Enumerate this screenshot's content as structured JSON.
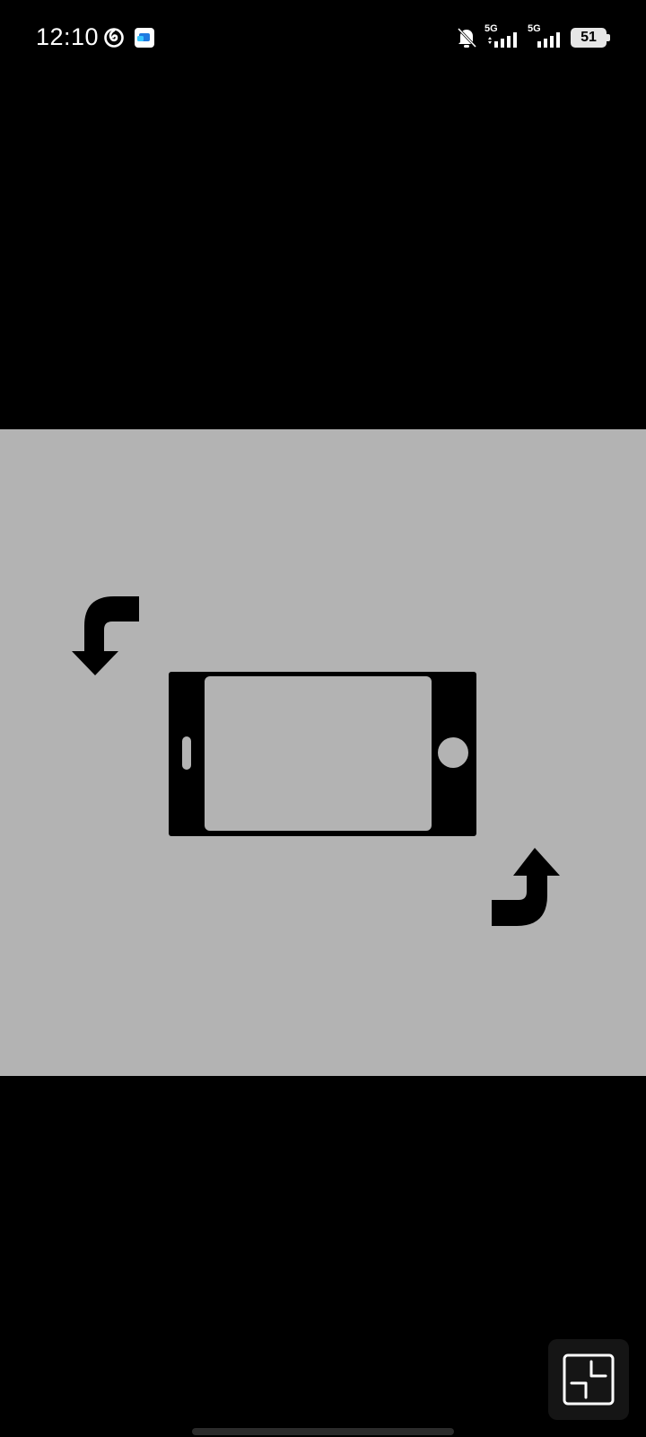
{
  "status_bar": {
    "time": "12:10",
    "network_1": "5G",
    "network_2": "5G",
    "battery": "51"
  },
  "icons": {
    "left": [
      "swirl-app-icon",
      "message-app-icon"
    ],
    "right": [
      "bell-off-icon",
      "signal-5g-icon",
      "signal-5g-icon",
      "battery-icon"
    ],
    "content": [
      "phone-landscape-icon",
      "rotate-arrow-top-left-icon",
      "rotate-arrow-bottom-right-icon"
    ],
    "action": "exit-fullscreen-icon"
  },
  "colors": {
    "background": "#000000",
    "panel": "#b3b3b3",
    "icon": "#000000",
    "button": "#151515"
  }
}
